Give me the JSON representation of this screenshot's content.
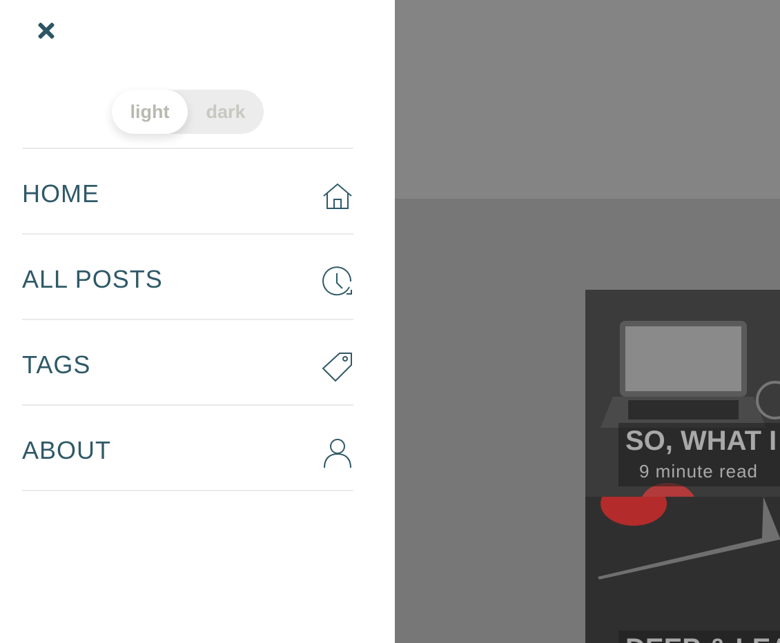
{
  "drawer": {
    "theme_toggle": {
      "light_label": "light",
      "dark_label": "dark",
      "selected": "light"
    },
    "menu": [
      {
        "label": "HOME",
        "icon": "home-icon"
      },
      {
        "label": "ALL POSTS",
        "icon": "clock-icon"
      },
      {
        "label": "TAGS",
        "icon": "tag-icon"
      },
      {
        "label": "ABOUT",
        "icon": "user-icon"
      }
    ]
  },
  "background": {
    "posts": [
      {
        "title": "SO, WHAT I",
        "meta": "9 minute read"
      },
      {
        "title": "DEEP & LEA",
        "meta": ""
      }
    ]
  },
  "colors": {
    "accent": "#2f5967",
    "overlay": "#7a7a7a",
    "drawer_bg": "#ffffff"
  }
}
